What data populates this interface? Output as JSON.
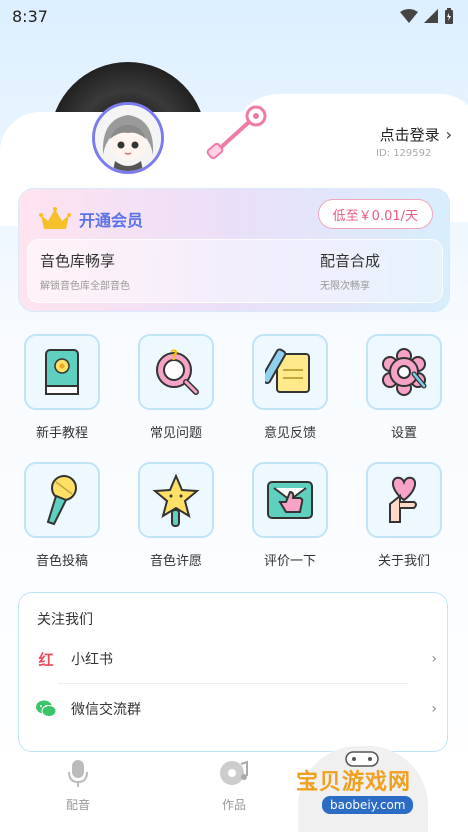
{
  "status_bar": {
    "time": "8:37"
  },
  "profile": {
    "login_label": "点击登录",
    "user_id": "ID: 129592"
  },
  "vip": {
    "title": "开通会员",
    "price_button": "低至￥0.01/天",
    "perks": [
      {
        "title": "音色库畅享",
        "subtitle": "解锁音色库全部音色"
      },
      {
        "title": "配音合成",
        "subtitle": "无限次畅享"
      }
    ]
  },
  "menu": [
    {
      "label": "新手教程",
      "icon": "book-icon"
    },
    {
      "label": "常见问题",
      "icon": "question-icon"
    },
    {
      "label": "意见反馈",
      "icon": "feedback-icon"
    },
    {
      "label": "设置",
      "icon": "gear-icon"
    },
    {
      "label": "音色投稿",
      "icon": "microphone-icon"
    },
    {
      "label": "音色许愿",
      "icon": "star-wand-icon"
    },
    {
      "label": "评价一下",
      "icon": "thumbs-up-icon"
    },
    {
      "label": "关于我们",
      "icon": "heart-hand-icon"
    }
  ],
  "follow": {
    "title": "关注我们",
    "items": [
      {
        "label": "小红书",
        "icon": "xiaohongshu-icon",
        "badge": "红"
      },
      {
        "label": "微信交流群",
        "icon": "wechat-icon"
      }
    ]
  },
  "tabs": [
    {
      "label": "配音",
      "icon": "microphone-tab-icon"
    },
    {
      "label": "作品",
      "icon": "music-disc-icon"
    }
  ],
  "watermark": {
    "text": "宝贝游戏网",
    "url": "baobeiy.com"
  },
  "colors": {
    "accent": "#5b72ea",
    "price": "#e85a82",
    "icon_border": "#bfe4f6"
  }
}
